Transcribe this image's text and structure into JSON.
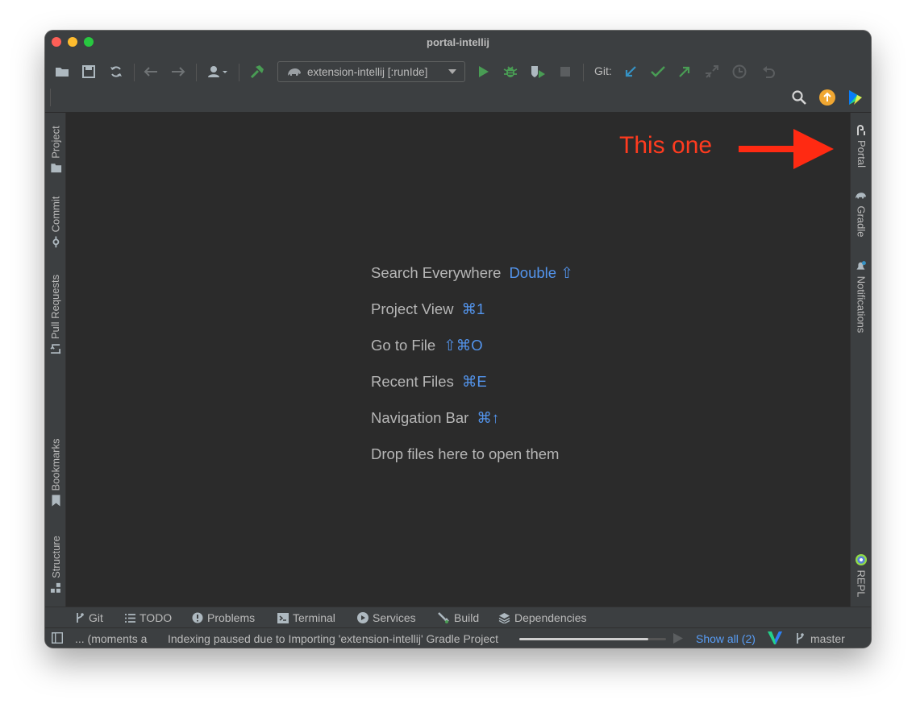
{
  "window": {
    "title": "portal-intellij"
  },
  "toolbar": {
    "run_config_label": "extension-intellij [:runIde]",
    "git_label": "Git:"
  },
  "left_tabs": [
    {
      "label": "Project"
    },
    {
      "label": "Commit"
    },
    {
      "label": "Pull Requests"
    },
    {
      "label": "Bookmarks"
    },
    {
      "label": "Structure"
    }
  ],
  "right_tabs": [
    {
      "label": "Portal"
    },
    {
      "label": "Gradle"
    },
    {
      "label": "Notifications"
    },
    {
      "label": "REPL"
    }
  ],
  "editor": {
    "tips": [
      {
        "label": "Search Everywhere",
        "shortcut": "Double ⇧"
      },
      {
        "label": "Project View",
        "shortcut": "⌘1"
      },
      {
        "label": "Go to File",
        "shortcut": "⇧⌘O"
      },
      {
        "label": "Recent Files",
        "shortcut": "⌘E"
      },
      {
        "label": "Navigation Bar",
        "shortcut": "⌘↑"
      },
      {
        "label": "Drop files here to open them",
        "shortcut": ""
      }
    ]
  },
  "annotation": {
    "text": "This one",
    "color": "#ff3b1f"
  },
  "bottom_tabs": [
    {
      "label": "Git"
    },
    {
      "label": "TODO"
    },
    {
      "label": "Problems"
    },
    {
      "label": "Terminal"
    },
    {
      "label": "Services"
    },
    {
      "label": "Build"
    },
    {
      "label": "Dependencies"
    }
  ],
  "status": {
    "left_text": "... (moments a",
    "indexing_text": "Indexing paused due to Importing 'extension-intellij' Gradle Project",
    "progress": 0.88,
    "show_all": "Show all (2)",
    "branch": "master"
  },
  "colors": {
    "accent_blue": "#5394ec",
    "run_green": "#499c54",
    "update_orange": "#f0a732"
  }
}
